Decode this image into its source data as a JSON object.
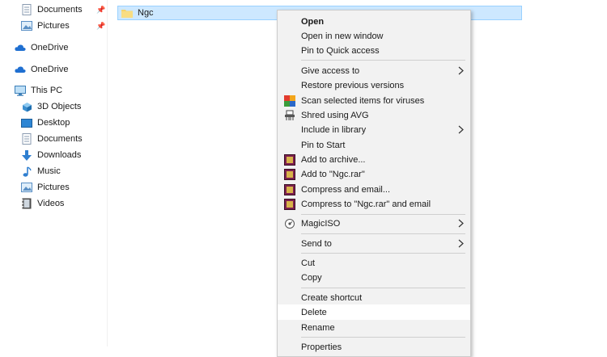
{
  "nav": {
    "quick_access": [
      {
        "label": "Documents",
        "icon": "documents-icon",
        "pinned": true
      },
      {
        "label": "Pictures",
        "icon": "pictures-icon",
        "pinned": true
      }
    ],
    "onedrive_1": {
      "label": "OneDrive",
      "icon": "onedrive-icon"
    },
    "onedrive_2": {
      "label": "OneDrive",
      "icon": "onedrive-icon"
    },
    "this_pc": {
      "label": "This PC",
      "icon": "this-pc-icon"
    },
    "pc_items": [
      {
        "label": "3D Objects",
        "icon": "3d-objects-icon"
      },
      {
        "label": "Desktop",
        "icon": "desktop-icon"
      },
      {
        "label": "Documents",
        "icon": "documents-icon"
      },
      {
        "label": "Downloads",
        "icon": "downloads-icon"
      },
      {
        "label": "Music",
        "icon": "music-icon"
      },
      {
        "label": "Pictures",
        "icon": "pictures-icon"
      },
      {
        "label": "Videos",
        "icon": "videos-icon"
      }
    ]
  },
  "content": {
    "selected_item": "Ngc"
  },
  "menu": {
    "open": "Open",
    "open_new_window": "Open in new window",
    "pin_quick_access": "Pin to Quick access",
    "give_access": "Give access to",
    "restore_versions": "Restore previous versions",
    "scan_viruses": "Scan selected items for viruses",
    "shred_avg": "Shred using AVG",
    "include_library": "Include in library",
    "pin_start": "Pin to Start",
    "add_archive": "Add to archive...",
    "add_ngc_rar": "Add to \"Ngc.rar\"",
    "compress_email": "Compress and email...",
    "compress_ngc_email": "Compress to \"Ngc.rar\" and email",
    "magiciso": "MagicISO",
    "send_to": "Send to",
    "cut": "Cut",
    "copy": "Copy",
    "create_shortcut": "Create shortcut",
    "delete": "Delete",
    "rename": "Rename",
    "properties": "Properties"
  },
  "colors": {
    "selection_bg": "#cde8ff",
    "menu_bg": "#f2f2f2",
    "folder": "#f4d36b"
  }
}
